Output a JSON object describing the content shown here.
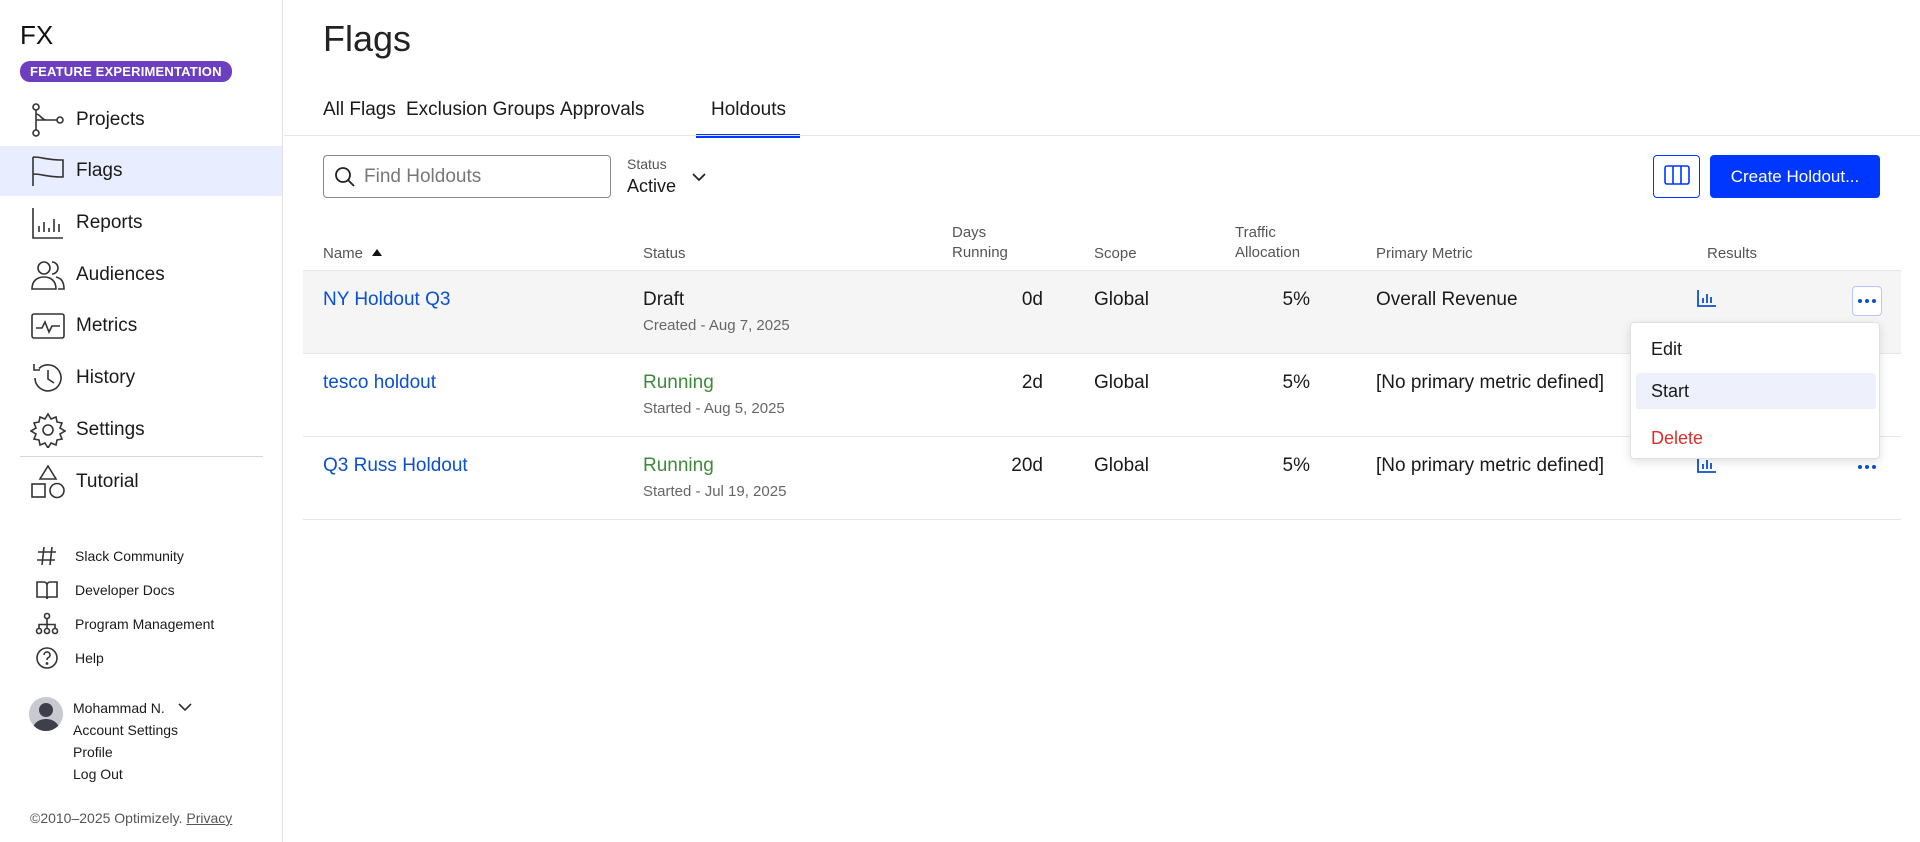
{
  "app": {
    "logo": "FX",
    "badge": "FEATURE EXPERIMENTATION"
  },
  "sidebar": {
    "items": [
      {
        "label": "Projects",
        "icon": "projects-icon"
      },
      {
        "label": "Flags",
        "icon": "flag-icon",
        "active": true
      },
      {
        "label": "Reports",
        "icon": "reports-icon"
      },
      {
        "label": "Audiences",
        "icon": "audiences-icon"
      },
      {
        "label": "Metrics",
        "icon": "metrics-icon"
      },
      {
        "label": "History",
        "icon": "history-icon"
      },
      {
        "label": "Settings",
        "icon": "gear-icon"
      },
      {
        "label": "Tutorial",
        "icon": "shapes-icon"
      }
    ],
    "secondary": [
      {
        "label": "Slack Community",
        "icon": "hash-icon"
      },
      {
        "label": "Developer Docs",
        "icon": "book-icon"
      },
      {
        "label": "Program Management",
        "icon": "org-chart-icon"
      },
      {
        "label": "Help",
        "icon": "help-icon"
      }
    ],
    "user": {
      "name": "Mohammad N.",
      "links": [
        "Account Settings",
        "Profile",
        "Log Out"
      ]
    },
    "footer": {
      "copyright": "©2010–2025 Optimizely.",
      "privacy": "Privacy"
    }
  },
  "page": {
    "title": "Flags"
  },
  "tabs": [
    "All Flags",
    "Exclusion Groups",
    "Approvals",
    "Holdouts"
  ],
  "toolbar": {
    "search_placeholder": "Find Holdouts",
    "status_label": "Status",
    "status_value": "Active",
    "create_label": "Create Holdout..."
  },
  "table": {
    "headers": {
      "name": "Name",
      "status": "Status",
      "days_1": "Days",
      "days_2": "Running",
      "scope": "Scope",
      "traffic_1": "Traffic",
      "traffic_2": "Allocation",
      "metric": "Primary Metric",
      "results": "Results"
    },
    "rows": [
      {
        "name": "NY Holdout Q3",
        "status": "Draft",
        "sub": "Created - Aug 7, 2025",
        "days": "0d",
        "scope": "Global",
        "traffic": "5%",
        "metric": "Overall Revenue"
      },
      {
        "name": "tesco holdout",
        "status": "Running",
        "sub": "Started - Aug 5, 2025",
        "days": "2d",
        "scope": "Global",
        "traffic": "5%",
        "metric": "[No primary metric defined]"
      },
      {
        "name": "Q3 Russ Holdout",
        "status": "Running",
        "sub": "Started - Jul 19, 2025",
        "days": "20d",
        "scope": "Global",
        "traffic": "5%",
        "metric": "[No primary metric defined]"
      }
    ]
  },
  "menu": {
    "items": [
      "Edit",
      "Start",
      "Delete"
    ]
  },
  "colors": {
    "accent": "#0037ff",
    "brand_badge": "#6c3fc1",
    "running": "#3f8a3a",
    "danger": "#d9302c",
    "link": "#0b50d0"
  }
}
